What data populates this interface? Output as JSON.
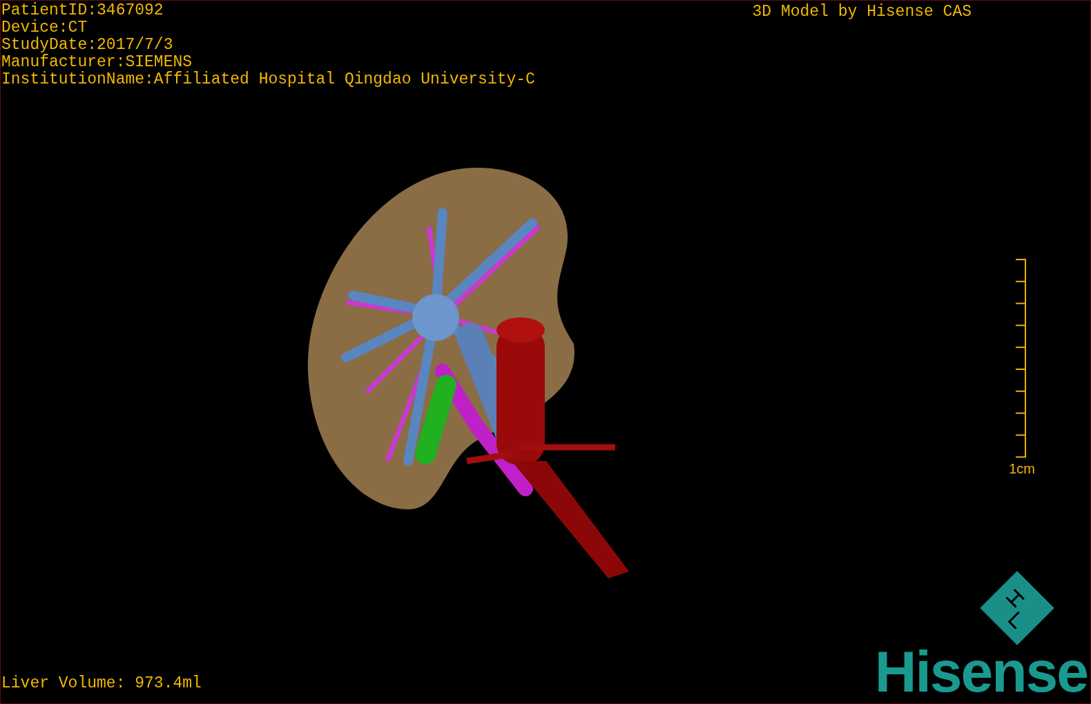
{
  "patient_info": [
    "PatientID:3467092",
    "Device:CT",
    "StudyDate:2017/7/3",
    "Manufacturer:SIEMENS",
    "InstitutionName:Affiliated Hospital Qingdao University-C"
  ],
  "title": "3D Model by Hisense CAS",
  "scale": {
    "label": "1cm"
  },
  "liver_volume": "Liver Volume: 973.4ml",
  "logo": {
    "text": "Hisense"
  }
}
